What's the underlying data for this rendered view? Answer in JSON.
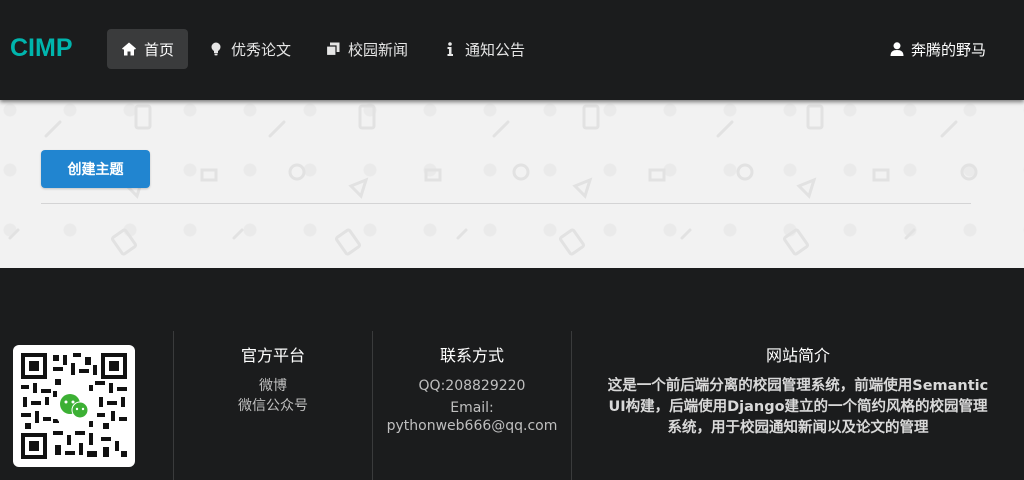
{
  "header": {
    "logo": "CIMP",
    "nav": [
      {
        "label": "首页",
        "icon": "home-icon",
        "active": true
      },
      {
        "label": "优秀论文",
        "icon": "lightbulb-icon",
        "active": false
      },
      {
        "label": "校园新闻",
        "icon": "clone-icon",
        "active": false
      },
      {
        "label": "通知公告",
        "icon": "info-icon",
        "active": false
      }
    ],
    "user": {
      "name": "奔腾的野马",
      "icon": "user-icon"
    }
  },
  "main": {
    "create_button": "创建主题"
  },
  "footer": {
    "qr_icon": "wechat-qr-code",
    "platform": {
      "title": "官方平台",
      "items": [
        "微博",
        "微信公众号"
      ]
    },
    "contact": {
      "title": "联系方式",
      "qq": "QQ:208829220",
      "email_label": "Email:",
      "email": "pythonweb666@qq.com"
    },
    "about": {
      "title": "网站简介",
      "lines": [
        "这是一个前后端分离的校园管理系统，前端使用Semantic",
        "UI构建，后端使用Django建立的一个简约风格的校园管理",
        "系统，用于校园通知新闻以及论文的管理"
      ]
    }
  },
  "colors": {
    "logo": "#00b5ad",
    "primary_button": "#2185d0",
    "header_bg": "#1b1c1d",
    "content_bg": "#f2f2f2"
  }
}
